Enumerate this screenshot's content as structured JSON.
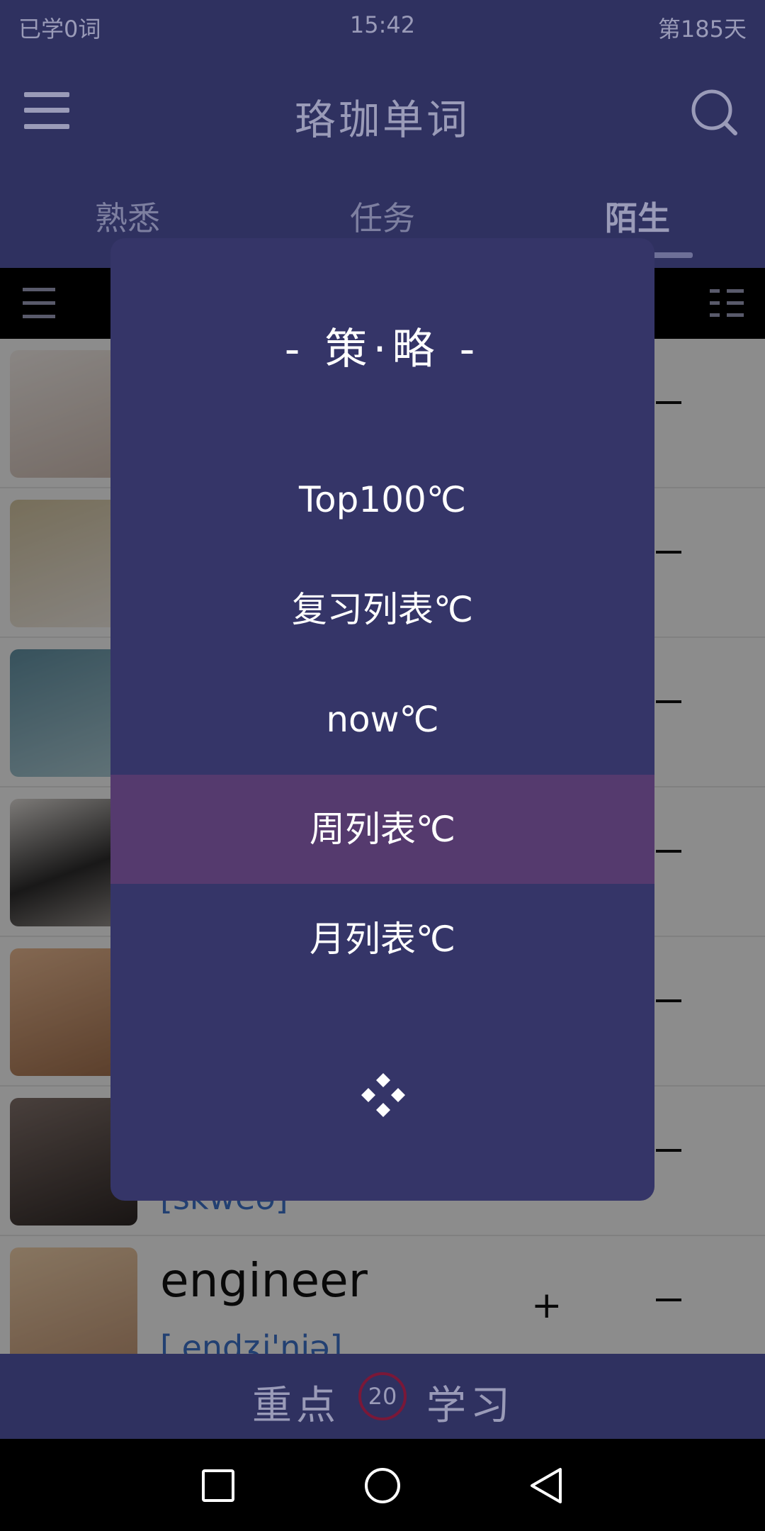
{
  "status_bar": {
    "left": "已学0词",
    "time": "15:42",
    "right": "第185天"
  },
  "header": {
    "title": "珞珈单词"
  },
  "tabs": [
    {
      "label": "熟悉",
      "active": false
    },
    {
      "label": "任务",
      "active": false
    },
    {
      "label": "陌生",
      "active": true
    }
  ],
  "list": {
    "rows": [
      {
        "word": "",
        "phonetic": "",
        "plus": "",
        "thumb_color": "#d9cfc9"
      },
      {
        "word": "",
        "phonetic": "",
        "plus": "",
        "thumb_color": "#b6a98a"
      },
      {
        "word": "",
        "phonetic": "",
        "plus": "",
        "thumb_color": "#7aa6b4"
      },
      {
        "word": "",
        "phonetic": "",
        "plus": "",
        "thumb_color": "#3c3a3a"
      },
      {
        "word": "",
        "phonetic": "",
        "plus": "",
        "thumb_color": "#c79a74"
      },
      {
        "word": "",
        "phonetic": "[skweə]",
        "plus": "",
        "thumb_color": "#5a4d49"
      },
      {
        "word": "engineer",
        "phonetic": "[ˌendʒi'niə]",
        "plus": "+",
        "thumb_color": "#cfa383"
      }
    ]
  },
  "dialog": {
    "title": "- 策·略 -",
    "options": [
      {
        "label": "Top100℃",
        "selected": false
      },
      {
        "label": "复习列表℃",
        "selected": false
      },
      {
        "label": "now℃",
        "selected": false
      },
      {
        "label": "周列表℃",
        "selected": true
      },
      {
        "label": "月列表℃",
        "selected": false
      }
    ],
    "footer_icon": "diamond-cluster-icon"
  },
  "study_bar": {
    "left_label": "重点",
    "count": "20",
    "right_label": "学习"
  },
  "colors": {
    "header_bg": "#2f3160",
    "dialog_bg": "#353568",
    "selected_bg": "#553a6e",
    "accent_ring": "#7a1838"
  }
}
